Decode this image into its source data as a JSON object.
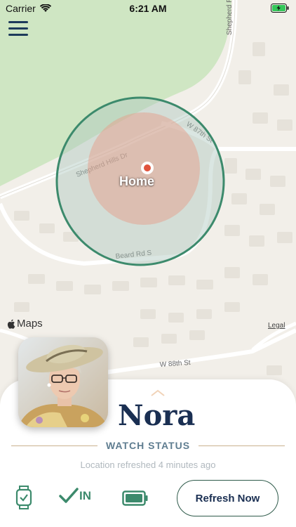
{
  "status_bar": {
    "carrier": "Carrier",
    "time": "6:21 AM"
  },
  "map": {
    "place_label": "Home",
    "streets": [
      "Shepherd Hills Dr",
      "W 87th St",
      "Beard Rd S",
      "W 88th St",
      "Shepherd R"
    ],
    "maps_label": "Maps",
    "legal_label": "Legal"
  },
  "profile": {
    "name": "Nora",
    "watch_status_label": "WATCH STATUS",
    "refreshed_text": "Location refreshed 4 minutes ago"
  },
  "status_row": {
    "checkin_label": "IN",
    "refresh_button_label": "Refresh Now"
  },
  "colors": {
    "accent_navy": "#1a2f52",
    "accent_green": "#3c8a6c",
    "geofence_stroke": "#3c8a6c",
    "home_zone": "#e6b8a8",
    "pin_red": "#e0533d",
    "gold_rule": "#c9b28e"
  },
  "icons": [
    "menu-icon",
    "wifi-icon",
    "battery-charging-icon",
    "apple-logo-icon",
    "chevron-up-icon",
    "smartwatch-check-icon",
    "checkmark-icon",
    "battery-full-icon"
  ]
}
